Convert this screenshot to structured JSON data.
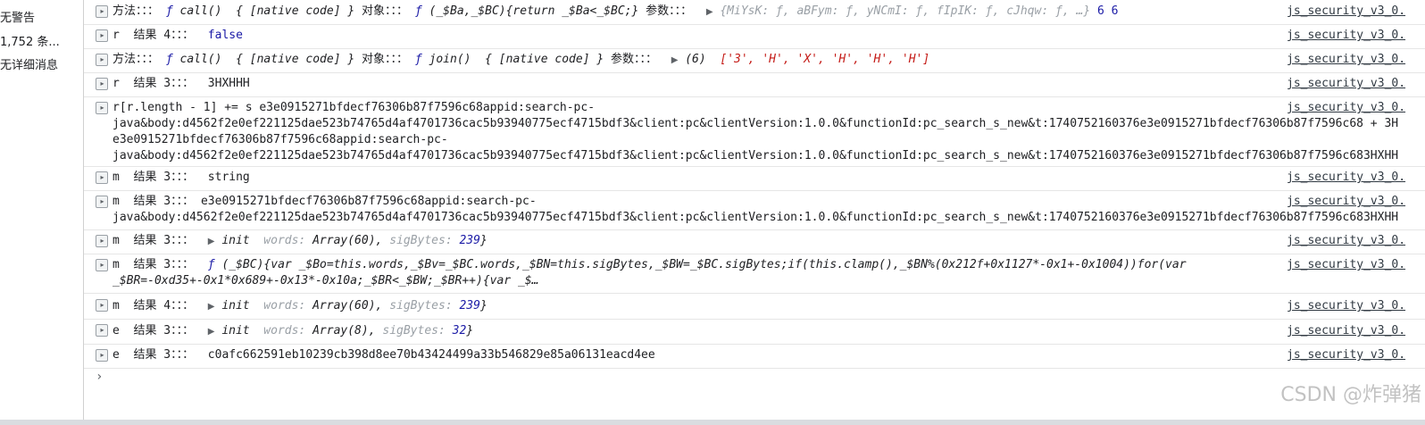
{
  "sidebar": {
    "items": [
      {
        "label": "无警告"
      },
      {
        "label": "1,752 条..."
      },
      {
        "label": "无详细消息"
      }
    ]
  },
  "console": {
    "source_label": "js_security_v3_0.",
    "rows": [
      {
        "prefix": "方法：：：",
        "f1": "ƒ",
        "call": "call()",
        "native": "{ [native code] }",
        "obj_label": "对象：：：",
        "f2": "ƒ",
        "fn_sig": "(_$Ba,_$BC){return _$Ba<_$BC;}",
        "args_label": "参数：：：",
        "args_preview": "{MiYsK: ƒ, aBFym: ƒ, yNCmI: ƒ, fIpIK: ƒ, cJhqw: ƒ, …}",
        "trail": "6 6"
      },
      {
        "text": "r  结果 4：：：",
        "value": "false"
      },
      {
        "prefix": "方法：：：",
        "f1": "ƒ",
        "call": "call()",
        "native": "{ [native code] }",
        "obj_label": "对象：：：",
        "f2": "ƒ",
        "join": "join()",
        "native2": "{ [native code] }",
        "args_label": "参数：：：",
        "count": "(6)",
        "arr": "['3', 'H', 'X', 'H', 'H', 'H']"
      },
      {
        "text": "r  结果 3：：：",
        "value": "3HXHHH"
      },
      {
        "line1": "r[r.length - 1] += s e3e0915271bfdecf76306b87f7596c68appid:search-pc-",
        "line2": "java&body:d4562f2e0ef221125dae523b74765d4af4701736cac5b93940775ecf4715bdf3&client:pc&clientVersion:1.0.0&functionId:pc_search_s_new&t:1740752160376e3e0915271bfdecf76306b87f7596c68 + 3H",
        "line3": "e3e0915271bfdecf76306b87f7596c68appid:search-pc-",
        "line4": "java&body:d4562f2e0ef221125dae523b74765d4af4701736cac5b93940775ecf4715bdf3&client:pc&clientVersion:1.0.0&functionId:pc_search_s_new&t:1740752160376e3e0915271bfdecf76306b87f7596c683HXHH"
      },
      {
        "text": "m  结果 3：：：",
        "value": "string"
      },
      {
        "text": "m  结果 3：：：",
        "line1": "e3e0915271bfdecf76306b87f7596c68appid:search-pc-",
        "line2": "java&body:d4562f2e0ef221125dae523b74765d4af4701736cac5b93940775ecf4715bdf3&client:pc&clientVersion:1.0.0&functionId:pc_search_s_new&t:1740752160376e3e0915271bfdecf76306b87f7596c683HXHH"
      },
      {
        "text": "m  结果 3：：：",
        "tri": "▶",
        "init": "init",
        "words": "words:",
        "wordsval": "Array(60),",
        "sig": "sigBytes:",
        "sigval": "239"
      },
      {
        "text": "m  结果 3：：：",
        "f": "ƒ",
        "line1": "(_$BC){var _$Bo=this.words,_$Bv=_$BC.words,_$BN=this.sigBytes,_$BW=_$BC.sigBytes;if(this.clamp(),_$BN%(0x212f+0x1127*-0x1+-0x1004))for(var",
        "line2": "_$BR=-0xd35+-0x1*0x689+-0x13*-0x10a;_$BR<_$BW;_$BR++){var _$…"
      },
      {
        "text": "m  结果 4：：：",
        "tri": "▶",
        "init": "init",
        "words": "words:",
        "wordsval": "Array(60),",
        "sig": "sigBytes:",
        "sigval": "239"
      },
      {
        "text": "e  结果 3：：：",
        "tri": "▶",
        "init": "init",
        "words": "words:",
        "wordsval": "Array(8),",
        "sig": "sigBytes:",
        "sigval": "32"
      },
      {
        "text": "e  结果 3：：：",
        "value": "c0afc662591eb10239cb398d8ee70b43424499a33b546829e85a06131eacd4ee"
      }
    ],
    "prompt": "›"
  },
  "watermark": "CSDN @炸弹猪",
  "icons": {
    "expander": "expand-icon",
    "prompt": "prompt-chevron-icon"
  }
}
